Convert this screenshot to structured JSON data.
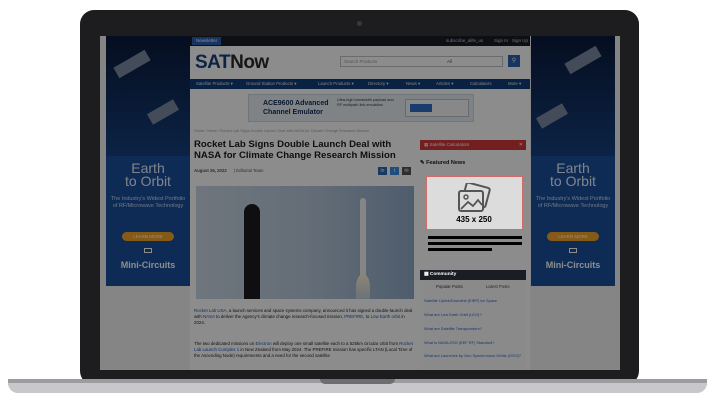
{
  "website": {
    "topbar": {
      "newsletter": "Newsletter",
      "links": [
        "subscribe_alife_us",
        "Sign In",
        "Sign Up"
      ]
    },
    "logo": {
      "part1": "SAT",
      "part2": "Now"
    },
    "search": {
      "placeholder": "Search Products",
      "select": "All"
    },
    "nav": [
      "Satellite Products ▾",
      "Ground Station Products ▾",
      "Launch Products ▾",
      "Directory ▾",
      "News ▾",
      "Articles ▾",
      "Calculators",
      "More ▾"
    ],
    "ad": {
      "title_line1": "ACE9600 Advanced",
      "title_line2": "Channel Emulator",
      "desc": "Ultra-high bandwidth payload and RF multipath link emulation"
    },
    "breadcrumb": "Home / News / Rocket Lab Signs Double Launch Deal with NASA for Climate Change Research Mission",
    "article": {
      "headline": "Rocket Lab Signs Double Launch Deal with NASA for Climate Change Research Mission",
      "date": "August 26, 2022",
      "author": "| Editorial Team",
      "share": [
        "in",
        "t",
        "✉"
      ],
      "p1_link1": "Rocket Lab USA",
      "p1_text1": ", a launch services and space systems company, announced it has signed a double-launch deal with ",
      "p1_link2": "NASA",
      "p1_text2": " to deliver the Agency's climate change research-focused mission, ",
      "p1_link3": "PREFIRE",
      "p1_text3": ", to ",
      "p1_link4": "Low Earth orbit",
      "p1_text4": " in 2024.",
      "p2_text1": "The two dedicated missions on ",
      "p2_link1": "Electron",
      "p2_text2": " will deploy one small satellite each to a 525km circular orbit from ",
      "p2_link2": "Rocket Lab Launch Complex 1",
      "p2_text3": " in New Zealand from May 2024. The PREFIRE mission has specific LTAN (Local Time of the Ascending Node) requirements and a need for the second satellite"
    },
    "sidebar": {
      "calculators": "Satellite Calculators",
      "featured": "Featured News",
      "placeholder_label": "435 x 250",
      "community": "Community",
      "tabs": [
        "Popular Posts",
        "Latest Posts"
      ],
      "posts": [
        "Satellite Uplink/Downlink (EIRP) for Space",
        "What are Low Earth Orbit (LEO)?",
        "What are Satellite Transponders?",
        "What is NASA ESG (EEF RF) Standard?",
        "What are Launches by Geo Synchronous Orbits (GSO)?"
      ]
    },
    "skyscraper": {
      "title_line1": "Earth",
      "title_line2": "to Orbit",
      "sub": "The Industry's Widest Portfolio of RF/Microwave Technology",
      "button": "LEARN MORE",
      "brand": "Mini-Circuits"
    }
  },
  "colors": {
    "laptop_bezel": "#1d1d1f",
    "brand_blue": "#123d78",
    "accent_red": "#d33a3a",
    "link_blue": "#1f56b3"
  }
}
